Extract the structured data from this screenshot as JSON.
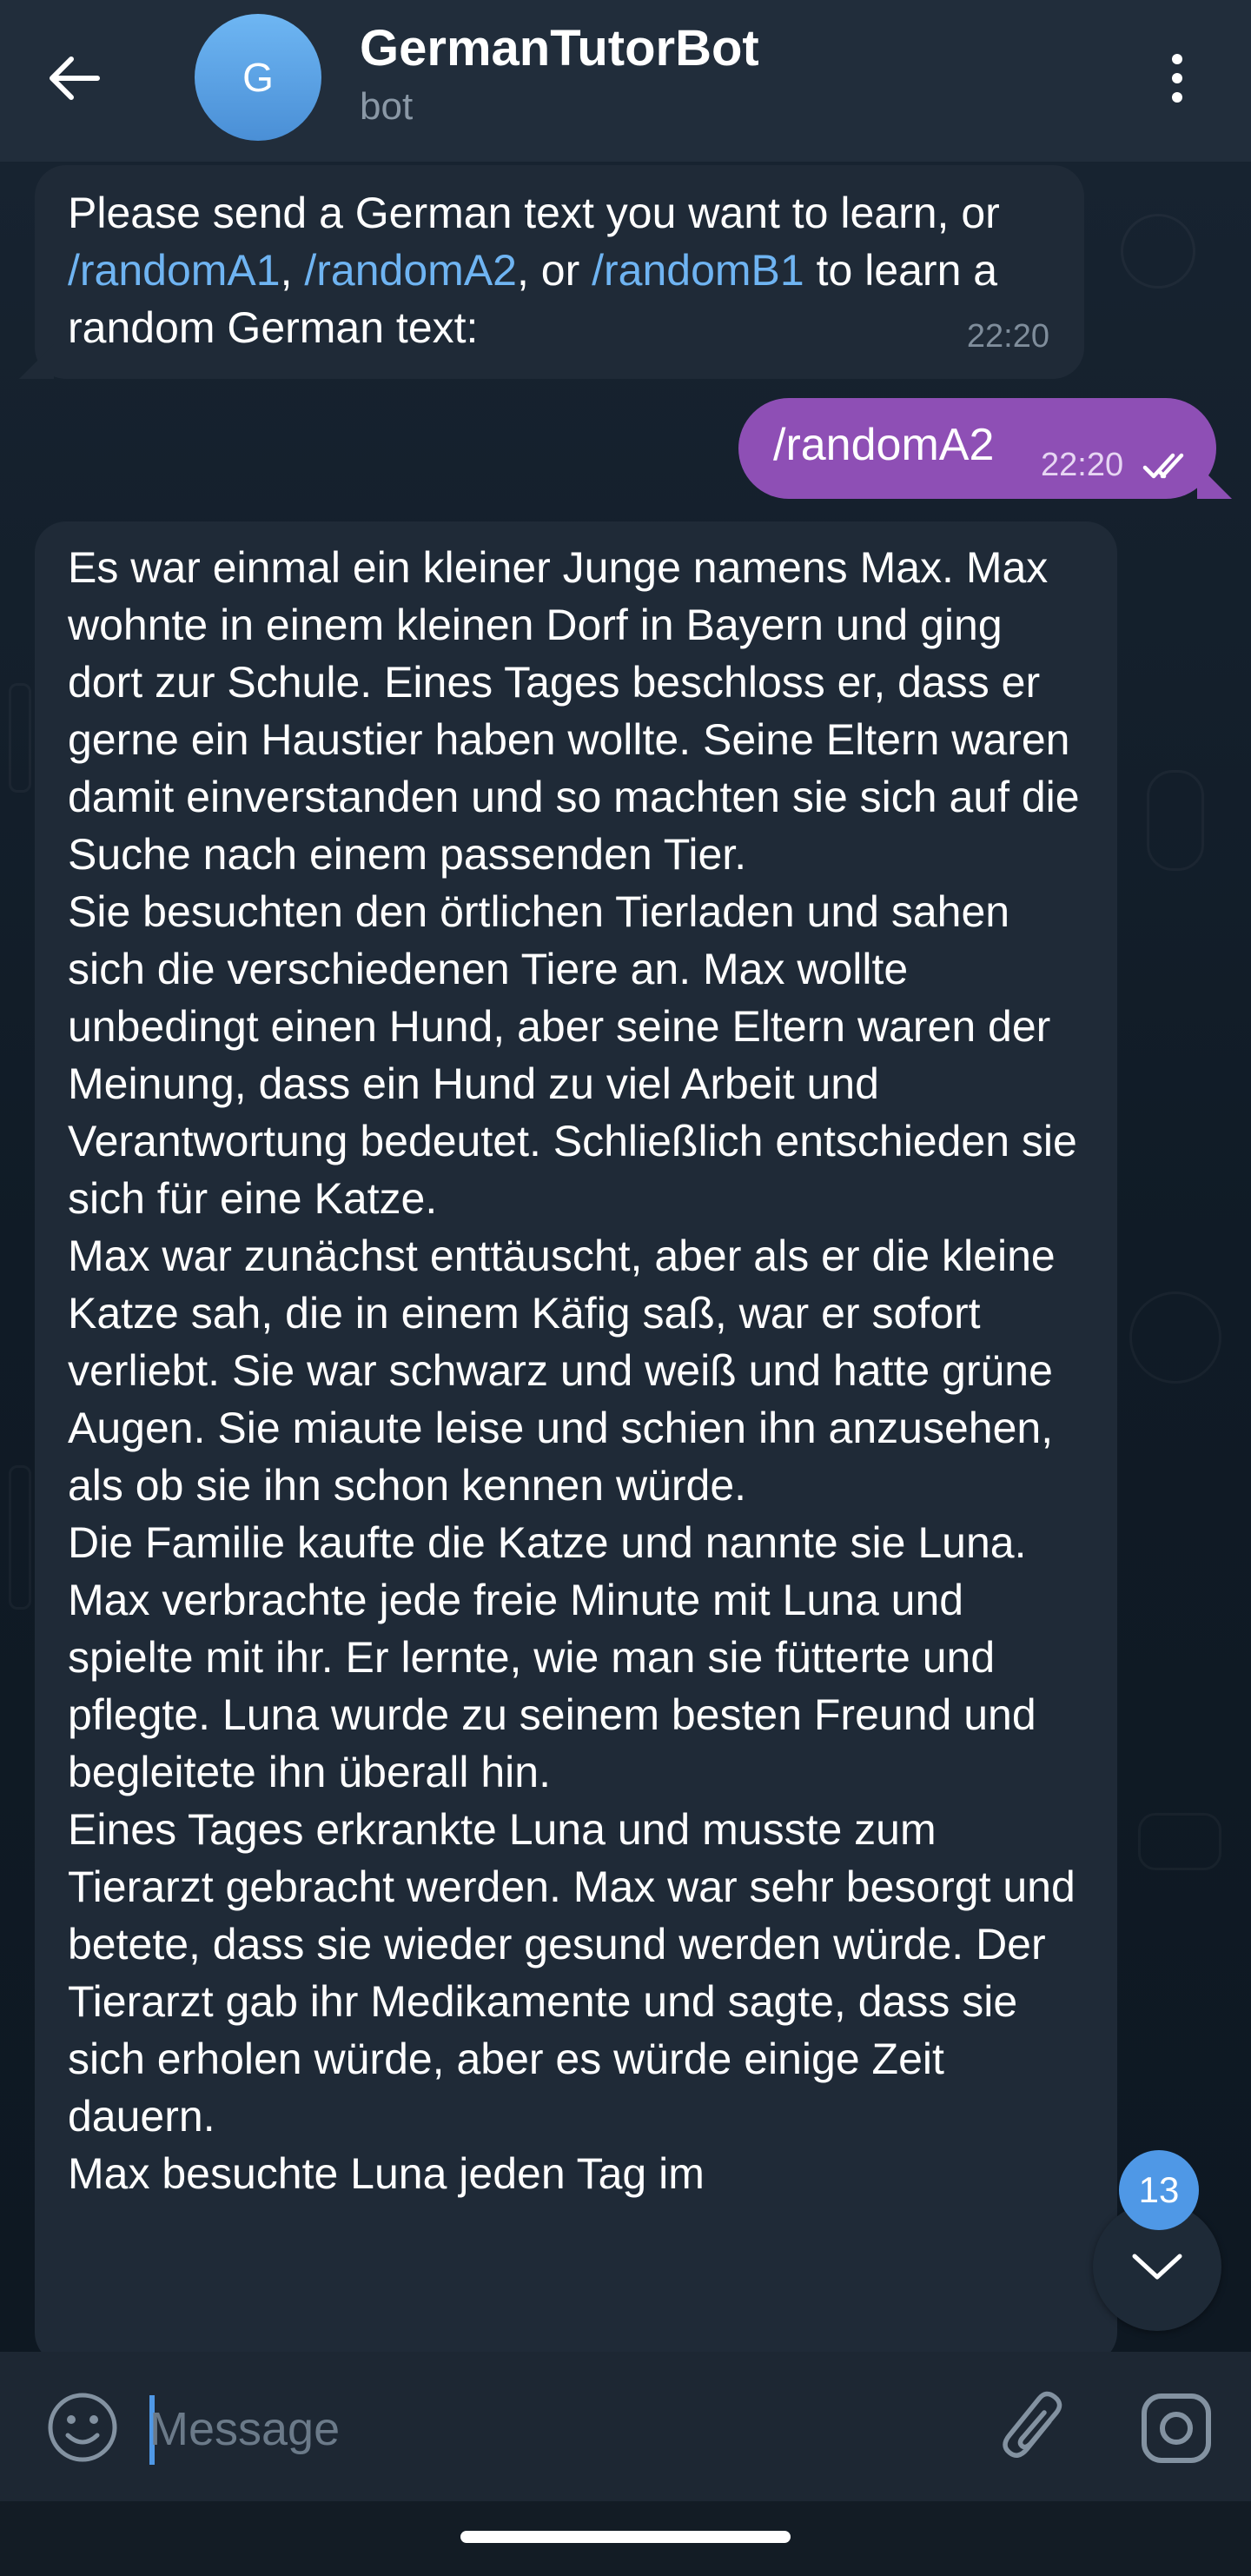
{
  "header": {
    "avatar_letter": "G",
    "title": "GermanTutorBot",
    "subtitle": "bot",
    "back_icon": "arrow-left-icon",
    "menu_icon": "more-vertical-icon"
  },
  "messages": {
    "bot_prompt": {
      "text_before": "Please send a German text you want to learn, or ",
      "link1": "/randomA1",
      "sep1": ", ",
      "link2": "/randomA2",
      "sep2": ", or ",
      "link3": "/randomB1",
      "text_after": " to learn a random German text:",
      "time": "22:20"
    },
    "user_command": {
      "text": "/randomA2",
      "time": "22:20",
      "status_icon": "double-check-icon"
    },
    "story": {
      "paragraphs": [
        "Es war einmal ein kleiner Junge namens Max. Max wohnte in einem kleinen Dorf in Bayern und ging dort zur Schule. Eines Tages beschloss er, dass er gerne ein Haustier haben wollte. Seine Eltern waren damit einverstanden und so machten sie sich auf die Suche nach einem passenden Tier.",
        "Sie besuchten den örtlichen Tierladen und sahen sich die verschiedenen Tiere an. Max wollte unbedingt einen Hund, aber seine Eltern waren der Meinung, dass ein Hund zu viel Arbeit und Verantwortung bedeutet. Schließlich entschieden sie sich für eine Katze.",
        "Max war zunächst enttäuscht, aber als er die kleine Katze sah, die in einem Käfig saß, war er sofort verliebt. Sie war schwarz und weiß und hatte grüne Augen. Sie miaute leise und schien ihn anzusehen, als ob sie ihn schon kennen würde.",
        "Die Familie kaufte die Katze und nannte sie Luna. Max verbrachte jede freie Minute mit Luna und spielte mit ihr. Er lernte, wie man sie fütterte und pflegte. Luna wurde zu seinem besten Freund und begleitete ihn überall hin.",
        "Eines Tages erkrankte Luna und musste zum Tierarzt gebracht werden. Max war sehr besorgt und betete, dass sie wieder gesund werden würde. Der Tierarzt gab ihr Medikamente und sagte, dass sie sich erholen würde, aber es würde einige Zeit dauern.",
        "Max besuchte Luna jeden Tag im"
      ]
    }
  },
  "scroll_down": {
    "unread_count": "13",
    "icon": "chevron-down-icon"
  },
  "composer": {
    "placeholder": "Message",
    "emoji_icon": "emoji-icon",
    "attach_icon": "paperclip-icon",
    "camera_icon": "camera-icon"
  },
  "colors": {
    "header_bg": "#212d3b",
    "incoming_bubble": "#1f2a37",
    "outgoing_bubble": "#8e4fb5",
    "link": "#6fb4f2",
    "badge": "#4f98e6"
  }
}
